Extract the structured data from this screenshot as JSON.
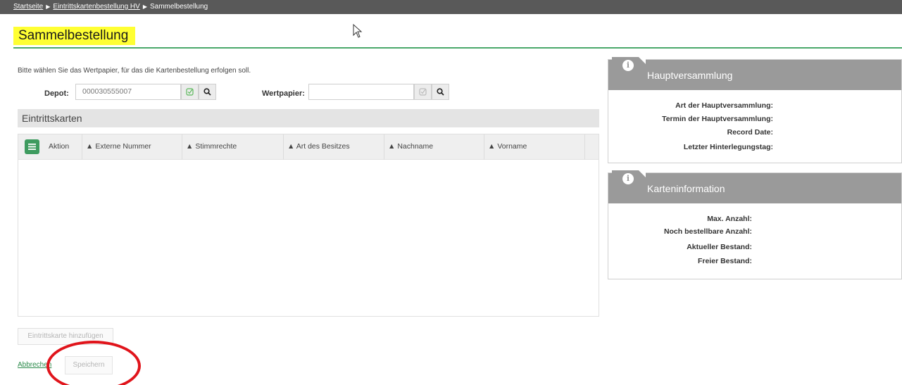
{
  "breadcrumb": {
    "items": [
      "Startseite",
      "Eintrittskartenbestellung HV",
      "Sammelbestellung"
    ]
  },
  "page": {
    "title": "Sammelbestellung",
    "instruction": "Bitte wählen Sie das Wertpapier, für das die Kartenbestellung erfolgen soll."
  },
  "form": {
    "depot_label": "Depot:",
    "depot_value": "000030555007",
    "wertpapier_label": "Wertpapier:",
    "wertpapier_value": ""
  },
  "eintrittskarten": {
    "section_title": "Eintrittskarten",
    "columns": [
      "Aktion",
      "Externe Nummer",
      "Stimmrechte",
      "Art des Besitzes",
      "Nachname",
      "Vorname"
    ],
    "rows": []
  },
  "actions": {
    "add_card": "Eintrittskarte hinzufügen",
    "cancel": "Abbrechen",
    "save": "Speichern"
  },
  "hauptversammlung": {
    "title": "Hauptversammlung",
    "fields": [
      "Art der Hauptversammlung:",
      "Termin der Hauptversammlung:",
      "Record Date:",
      "Letzter Hinterlegungstag:"
    ]
  },
  "karteninformation": {
    "title": "Karteninformation",
    "fields": [
      "Max. Anzahl:",
      "Noch bestellbare Anzahl:",
      "Aktueller Bestand:",
      "Freier Bestand:"
    ]
  },
  "colors": {
    "accent_green": "#3e9b5f",
    "highlight_yellow": "#ffff33",
    "annotation_red": "#e0141b",
    "panel_header_gray": "#9a9a9a"
  },
  "icons": [
    "info-icon",
    "search-icon",
    "clear-icon",
    "menu-icon",
    "sort-icon",
    "cursor-icon"
  ]
}
